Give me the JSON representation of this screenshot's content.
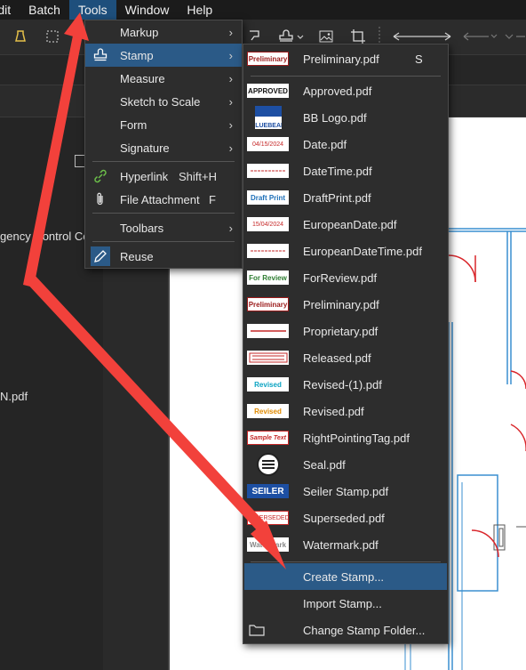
{
  "menubar": {
    "items": [
      {
        "label": "Edit"
      },
      {
        "label": "Batch"
      },
      {
        "label": "Tools"
      },
      {
        "label": "Window"
      },
      {
        "label": "Help"
      }
    ]
  },
  "left_panel": {
    "line1": "gency Control Ce...",
    "line2": "N.pdf"
  },
  "tools_menu": {
    "items": [
      {
        "label": "Markup",
        "shortcut": "",
        "arrow": "›"
      },
      {
        "label": "Stamp",
        "shortcut": "",
        "arrow": "›"
      },
      {
        "label": "Measure",
        "shortcut": "",
        "arrow": "›"
      },
      {
        "label": "Sketch to Scale",
        "shortcut": "",
        "arrow": "›"
      },
      {
        "label": "Form",
        "shortcut": "",
        "arrow": "›"
      },
      {
        "label": "Signature",
        "shortcut": "",
        "arrow": "›"
      },
      {
        "label": "Hyperlink",
        "shortcut": "Shift+H",
        "arrow": ""
      },
      {
        "label": "File Attachment",
        "shortcut": "F",
        "arrow": ""
      },
      {
        "label": "Toolbars",
        "shortcut": "",
        "arrow": "›"
      },
      {
        "label": "Reuse",
        "shortcut": "",
        "arrow": ""
      }
    ]
  },
  "stamp_menu": {
    "items": [
      {
        "label": "Preliminary.pdf",
        "key": "S",
        "thumb": "Preliminary",
        "thumb_color": "#9b1b1b"
      },
      {
        "label": "Approved.pdf",
        "key": "",
        "thumb": "APPROVED",
        "thumb_color": "#111111"
      },
      {
        "label": "BB Logo.pdf",
        "key": "",
        "thumb": "BLUEBEAM",
        "thumb_color": "#1d4fa3"
      },
      {
        "label": "Date.pdf",
        "key": "",
        "thumb": "04/15/2024",
        "thumb_color": "#c62828"
      },
      {
        "label": "DateTime.pdf",
        "key": "",
        "thumb": "",
        "thumb_color": "#c62828"
      },
      {
        "label": "DraftPrint.pdf",
        "key": "",
        "thumb": "Draft Print",
        "thumb_color": "#1d6fb8"
      },
      {
        "label": "EuropeanDate.pdf",
        "key": "",
        "thumb": "15/04/2024",
        "thumb_color": "#c62828"
      },
      {
        "label": "EuropeanDateTime.pdf",
        "key": "",
        "thumb": "",
        "thumb_color": "#c62828"
      },
      {
        "label": "ForReview.pdf",
        "key": "",
        "thumb": "For Review",
        "thumb_color": "#2e7d32"
      },
      {
        "label": "Preliminary.pdf",
        "key": "",
        "thumb": "Preliminary",
        "thumb_color": "#9b1b1b"
      },
      {
        "label": "Proprietary.pdf",
        "key": "",
        "thumb": "",
        "thumb_color": "#c62828"
      },
      {
        "label": "Released.pdf",
        "key": "",
        "thumb": "",
        "thumb_color": "#c62828"
      },
      {
        "label": "Revised-(1).pdf",
        "key": "",
        "thumb": "Revised",
        "thumb_color": "#0aa3c2"
      },
      {
        "label": "Revised.pdf",
        "key": "",
        "thumb": "Revised",
        "thumb_color": "#e08a00"
      },
      {
        "label": "RightPointingTag.pdf",
        "key": "",
        "thumb": "Sample Text",
        "thumb_color": "#c62828"
      },
      {
        "label": "Seal.pdf",
        "key": "",
        "thumb": "",
        "thumb_color": "#222222"
      },
      {
        "label": "Seiler Stamp.pdf",
        "key": "",
        "thumb": "SEILER",
        "thumb_color": "#1d4fa3"
      },
      {
        "label": "Superseded.pdf",
        "key": "",
        "thumb": "SUPERSEDED",
        "thumb_color": "#c62828"
      },
      {
        "label": "Watermark.pdf",
        "key": "",
        "thumb": "Watermark",
        "thumb_color": "#888888"
      },
      {
        "label": "Create Stamp...",
        "key": "",
        "thumb": "",
        "thumb_color": ""
      },
      {
        "label": "Import Stamp...",
        "key": "",
        "thumb": "",
        "thumb_color": ""
      },
      {
        "label": "Change Stamp Folder...",
        "key": "",
        "thumb": "",
        "thumb_color": ""
      }
    ]
  },
  "colors": {
    "highlight": "#2b5a87",
    "annotation_arrow": "#f2413b",
    "plan_lines": "#3a8fd0",
    "door_arcs": "#d9262b"
  }
}
